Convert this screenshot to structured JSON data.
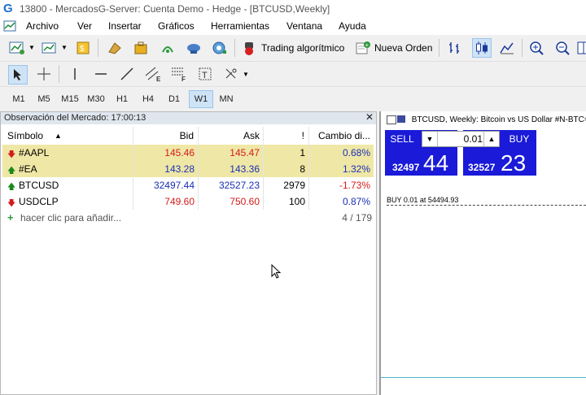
{
  "window": {
    "title": "13800 - MercadosG-Server: Cuenta Demo - Hedge - [BTCUSD,Weekly]"
  },
  "menu": [
    "Archivo",
    "Ver",
    "Insertar",
    "Gráficos",
    "Herramientas",
    "Ventana",
    "Ayuda"
  ],
  "toolbar": {
    "algo_label": "Trading algorítmico",
    "new_order_label": "Nueva Orden"
  },
  "timeframes": [
    "M1",
    "M5",
    "M15",
    "M30",
    "H1",
    "H4",
    "D1",
    "W1",
    "MN"
  ],
  "active_timeframe": "W1",
  "market_watch": {
    "title": "Observación del Mercado: 17:00:13",
    "columns": [
      "Símbolo",
      "Bid",
      "Ask",
      "!",
      "Cambio di..."
    ],
    "rows": [
      {
        "symbol": "#AAPL",
        "bid": "145.46",
        "ask": "145.47",
        "spread": "1",
        "change": "0.68%",
        "direction": "down"
      },
      {
        "symbol": "#EA",
        "bid": "143.28",
        "ask": "143.36",
        "spread": "8",
        "change": "1.32%",
        "direction": "up"
      },
      {
        "symbol": "BTCUSD",
        "bid": "32497.44",
        "ask": "32527.23",
        "spread": "2979",
        "change": "-1.73%",
        "direction": "up"
      },
      {
        "symbol": "USDCLP",
        "bid": "749.60",
        "ask": "750.60",
        "spread": "100",
        "change": "0.87%",
        "direction": "down"
      }
    ],
    "add_label": "hacer clic para añadir...",
    "count": "4 / 179"
  },
  "chart": {
    "title": "BTCUSD, Weekly:  Bitcoin vs US Dollar #N-BTC=",
    "sell_label": "SELL",
    "buy_label": "BUY",
    "lot": "0.01",
    "sell_price_small": "32497",
    "sell_price_big": "44",
    "buy_price_small": "32527",
    "buy_price_big": "23",
    "trade_label": "BUY 0.01 at 54494.93"
  },
  "colors": {
    "bid": "#1a2fb5",
    "ask_red": "#d21b1b",
    "highlight": "#efe7a6",
    "trade_panel": "#1a1ad8"
  }
}
